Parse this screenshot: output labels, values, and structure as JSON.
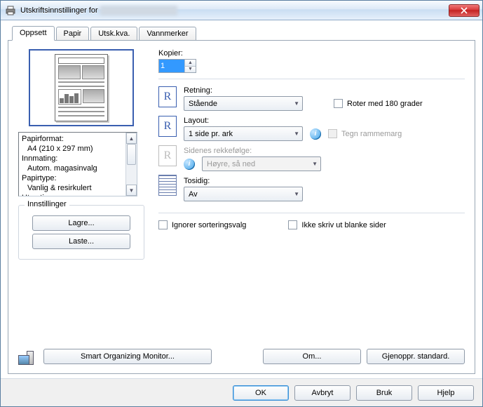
{
  "window": {
    "title_prefix": "Utskriftsinnstillinger for"
  },
  "tabs": [
    "Oppsett",
    "Papir",
    "Utsk.kva.",
    "Vannmerker"
  ],
  "active_tab": 0,
  "papirformat": {
    "lines": [
      "Papirformat:",
      "  A4 (210 x 297 mm)",
      "Innmating:",
      "  Autom. magasinvalg",
      "Papirtype:",
      "  Vanlig & resirkulert",
      "Utmating:"
    ]
  },
  "innstillinger": {
    "legend": "Innstillinger",
    "lagre": "Lagre...",
    "laste": "Laste..."
  },
  "kopier": {
    "label": "Kopier:",
    "value": "1"
  },
  "retning": {
    "label": "Retning:",
    "value": "Stående",
    "rotate_label": "Roter med 180 grader"
  },
  "layout": {
    "label": "Layout:",
    "value": "1 side pr. ark",
    "tegn_label": "Tegn rammemarg"
  },
  "sidenes": {
    "label": "Sidenes rekkefølge:",
    "value": "Høyre, så ned"
  },
  "tosidig": {
    "label": "Tosidig:",
    "value": "Av"
  },
  "options": {
    "ignore_sort": "Ignorer sorteringsvalg",
    "no_blank": "Ikke skriv ut blanke sider"
  },
  "lower": {
    "smart": "Smart Organizing Monitor...",
    "om": "Om...",
    "restore": "Gjenoppr. standard."
  },
  "dialog": {
    "ok": "OK",
    "cancel": "Avbryt",
    "apply": "Bruk",
    "help": "Hjelp"
  }
}
